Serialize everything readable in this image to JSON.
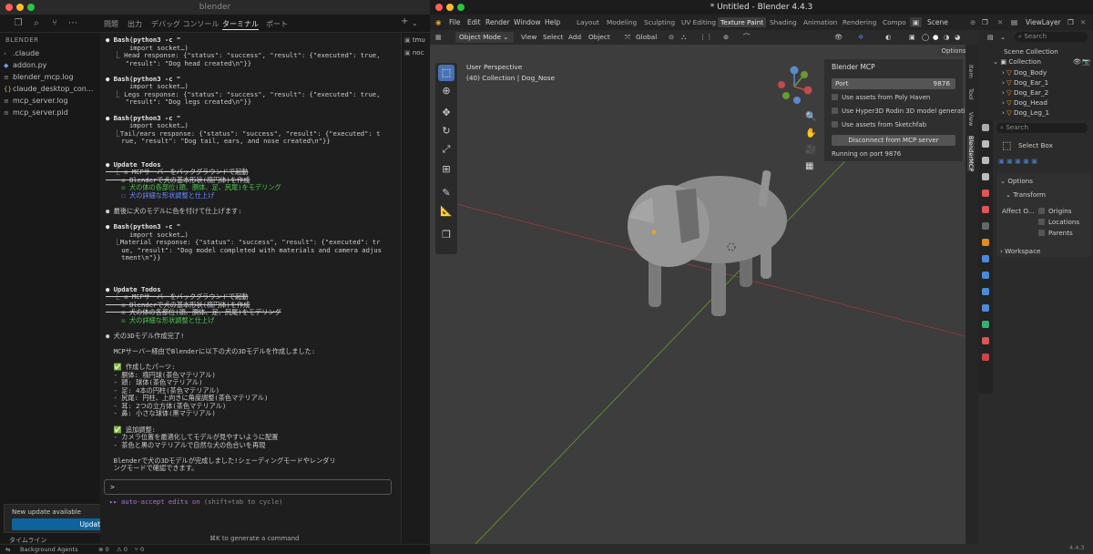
{
  "vscode": {
    "title": "blender",
    "panel_tabs": [
      "問題",
      "出力",
      "デバッグ コンソール",
      "ターミナル",
      "ポート"
    ],
    "explorer": {
      "header": "BLENDER",
      "items": [
        ".claude",
        "addon.py",
        "blender_mcp.log",
        "claude_desktop_con...",
        "mcp_server.log",
        "mcp_server.pid"
      ]
    },
    "right_tabs": [
      "tmu",
      "noc"
    ],
    "terminal_lines": [
      {
        "t": "● Bash(python3 -c \"",
        "c": "b"
      },
      {
        "t": "      import socket…)",
        "c": ""
      },
      {
        "t": "  ⎿ Head response: {\"status\": \"success\", \"result\": {\"executed\": true,",
        "c": ""
      },
      {
        "t": "     \"result\": \"Dog head created\\n\"}}",
        "c": ""
      },
      {
        "t": "",
        "c": ""
      },
      {
        "t": "● Bash(python3 -c \"",
        "c": "b"
      },
      {
        "t": "      import socket…)",
        "c": ""
      },
      {
        "t": "  ⎿ Legs response: {\"status\": \"success\", \"result\": {\"executed\": true,",
        "c": ""
      },
      {
        "t": "     \"result\": \"Dog legs created\\n\"}}",
        "c": ""
      },
      {
        "t": "",
        "c": ""
      },
      {
        "t": "● Bash(python3 -c \"",
        "c": "b"
      },
      {
        "t": "      import socket…)",
        "c": ""
      },
      {
        "t": "  ⎿Tail/ears response: {\"status\": \"success\", \"result\": {\"executed\": t",
        "c": ""
      },
      {
        "t": "    rue, \"result\": \"Dog tail, ears, and nose created\\n\"}}",
        "c": ""
      },
      {
        "t": "",
        "c": ""
      },
      {
        "t": "",
        "c": ""
      },
      {
        "t": "● Update Todos",
        "c": "b"
      },
      {
        "t": "  ⎿ ☒ MCPサーバーをバックグラウンドで起動",
        "c": "strike"
      },
      {
        "t": "    ☒ Blenderで犬の基本形状(楕円体)を作成",
        "c": "strike"
      },
      {
        "t": "    ☒ 犬の体の各部位(頭、胴体、足、尻尾)をモデリング",
        "c": "green"
      },
      {
        "t": "    ☐ 犬の詳細な形状調整と仕上げ",
        "c": "blue"
      },
      {
        "t": "",
        "c": ""
      },
      {
        "t": "● 最後に犬のモデルに色を付けて仕上げます:",
        "c": ""
      },
      {
        "t": "",
        "c": ""
      },
      {
        "t": "● Bash(python3 -c \"",
        "c": "b"
      },
      {
        "t": "      import socket…)",
        "c": ""
      },
      {
        "t": "  ⎿Material response: {\"status\": \"success\", \"result\": {\"executed\": tr",
        "c": ""
      },
      {
        "t": "    ue, \"result\": \"Dog model completed with materials and camera adjus",
        "c": ""
      },
      {
        "t": "    tment\\n\"}}",
        "c": ""
      },
      {
        "t": "",
        "c": ""
      },
      {
        "t": "",
        "c": ""
      },
      {
        "t": "",
        "c": ""
      },
      {
        "t": "● Update Todos",
        "c": "b"
      },
      {
        "t": "  ⎿ ☒ MCPサーバーをバックグラウンドで起動",
        "c": "strike"
      },
      {
        "t": "    ☒ Blenderで犬の基本形状(楕円体)を作成",
        "c": "strike"
      },
      {
        "t": "    ☒ 犬の体の各部位(頭、胴体、足、尻尾)をモデリング",
        "c": "strike"
      },
      {
        "t": "    ☒ 犬の詳細な形状調整と仕上げ",
        "c": "green"
      },
      {
        "t": "",
        "c": ""
      },
      {
        "t": "● 犬の3Dモデル作成完了!",
        "c": ""
      },
      {
        "t": "",
        "c": ""
      },
      {
        "t": "  MCPサーバー経由でBlenderに以下の犬の3Dモデルを作成しました:",
        "c": ""
      },
      {
        "t": "",
        "c": ""
      },
      {
        "t": "  ✅ 作成したパーツ:",
        "c": ""
      },
      {
        "t": "  - 胴体: 楕円球(茶色マテリアル)",
        "c": ""
      },
      {
        "t": "  - 頭: 球体(茶色マテリアル)",
        "c": ""
      },
      {
        "t": "  - 足: 4本の円柱(茶色マテリアル)",
        "c": ""
      },
      {
        "t": "  - 尻尾: 円柱、上向きに角度調整(茶色マテリアル)",
        "c": ""
      },
      {
        "t": "  - 耳: 2つの立方体(茶色マテリアル)",
        "c": ""
      },
      {
        "t": "  - 鼻: 小さな球体(黒マテリアル)",
        "c": ""
      },
      {
        "t": "",
        "c": ""
      },
      {
        "t": "  ✅ 追加調整:",
        "c": ""
      },
      {
        "t": "  - カメラ位置を最適化してモデルが見やすいように配置",
        "c": ""
      },
      {
        "t": "  - 茶色と黒のマテリアルで自然な犬の色合いを再現",
        "c": ""
      },
      {
        "t": "",
        "c": ""
      },
      {
        "t": "  Blenderで犬の3Dモデルが完成しました!シェーディングモードやレンダリ",
        "c": ""
      },
      {
        "t": "  ングモードで確認できます。",
        "c": ""
      }
    ],
    "prompt": ">",
    "auto_accept_main": "▸▸ auto-accept edits on",
    "auto_accept_hint": " (shift+tab to cycle)",
    "generate_hint": "⌘K to generate a command",
    "update_text": "New update available",
    "update_button": "Update now",
    "timeline": "タイムライン",
    "status": {
      "agents": "Background Agents",
      "errors": "⊗ 0",
      "warnings": "⚠ 0",
      "ports": "⑂ 0"
    }
  },
  "blender": {
    "title": "* Untitled - Blender 4.4.3",
    "menus": [
      "File",
      "Edit",
      "Render",
      "Window",
      "Help"
    ],
    "workspaces": [
      "Layout",
      "Modeling",
      "Sculpting",
      "UV Editing",
      "Texture Paint",
      "Shading",
      "Animation",
      "Rendering",
      "Compo"
    ],
    "active_workspace": "Texture Paint",
    "scene": "Scene",
    "view_layer": "ViewLayer",
    "mode": "Object Mode",
    "header_menus": [
      "View",
      "Select",
      "Add",
      "Object"
    ],
    "transform": "Global",
    "options_btn": "Options",
    "viewport": {
      "line1": "User Perspective",
      "line2": "(40) Collection | Dog_Nose"
    },
    "mcp_panel": {
      "title": "Blender MCP",
      "port_label": "Port",
      "port_value": "9876",
      "checkboxes": [
        "Use assets from Poly Haven",
        "Use Hyper3D Rodin 3D model generati...",
        "Use assets from Sketchfab"
      ],
      "disconnect": "Disconnect from MCP server",
      "running": "Running on port 9876"
    },
    "side_tabs": [
      "Item",
      "Tool",
      "View",
      "BlenderMCP"
    ],
    "outliner": {
      "search": "Search",
      "root": "Scene Collection",
      "collection": "Collection",
      "items": [
        "Dog_Body",
        "Dog_Ear_1",
        "Dog_Ear_2",
        "Dog_Head",
        "Dog_Leg_1"
      ]
    },
    "properties": {
      "search": "Search",
      "tool": "Select Box",
      "options": "Options",
      "transform": "Transform",
      "affect": "Affect O...",
      "affect_items": [
        "Origins",
        "Locations",
        "Parents"
      ],
      "workspace": "Workspace"
    },
    "version": "4.4.3"
  }
}
